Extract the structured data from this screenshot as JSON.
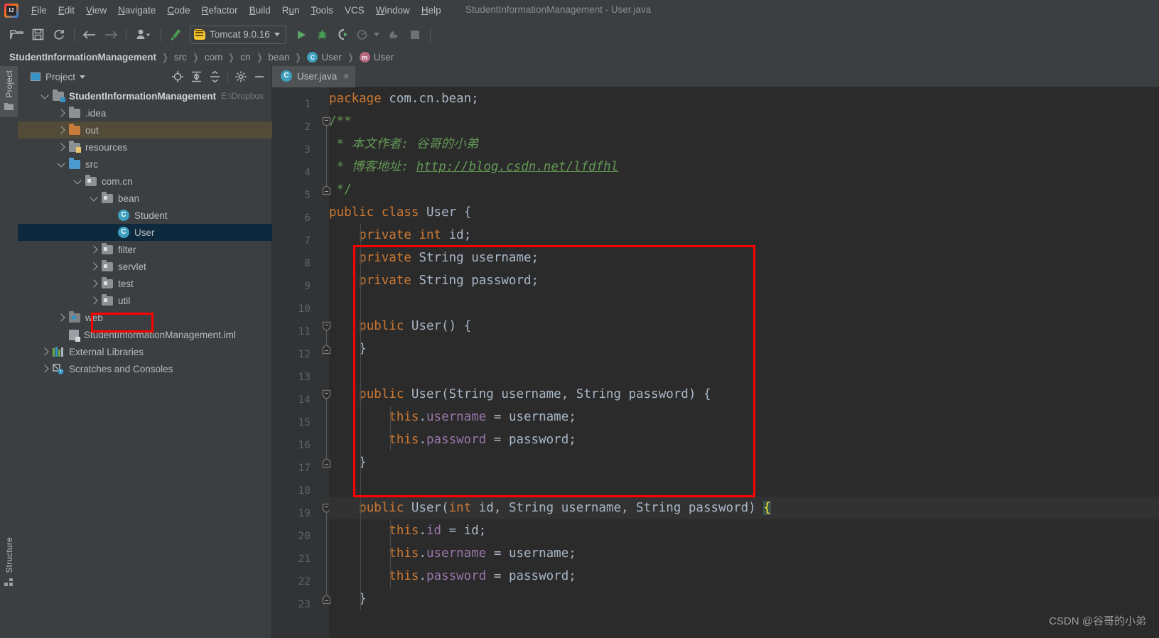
{
  "window": {
    "title": "StudentInformationManagement - User.java",
    "app_icon": "intellij-idea-logo"
  },
  "menubar": {
    "items": [
      {
        "label": "File",
        "mnemonic": "F"
      },
      {
        "label": "Edit",
        "mnemonic": "E"
      },
      {
        "label": "View",
        "mnemonic": "V"
      },
      {
        "label": "Navigate",
        "mnemonic": "N"
      },
      {
        "label": "Code",
        "mnemonic": "C"
      },
      {
        "label": "Refactor",
        "mnemonic": "R"
      },
      {
        "label": "Build",
        "mnemonic": "B"
      },
      {
        "label": "Run",
        "mnemonic": "u"
      },
      {
        "label": "Tools",
        "mnemonic": "T"
      },
      {
        "label": "VCS",
        "mnemonic": ""
      },
      {
        "label": "Window",
        "mnemonic": "W"
      },
      {
        "label": "Help",
        "mnemonic": "H"
      }
    ]
  },
  "toolbar": {
    "icons": [
      "open-folder-icon",
      "save-all-icon",
      "sync-refresh-icon",
      "navigate-back-icon",
      "navigate-forward-icon",
      "user-profile-icon",
      "build-hammer-icon"
    ],
    "run_config": {
      "label": "Tomcat 9.0.16",
      "icon": "tomcat-icon",
      "dropdown": "chevron-down-icon"
    },
    "run_label": "Run",
    "debug_label": "Debug",
    "run_coverage_label": "Run with Coverage",
    "profile_label": "Profile",
    "stop_label": "Stop"
  },
  "breadcrumb": {
    "items": [
      {
        "label": "StudentInformationManagement",
        "bold": true,
        "badge": ""
      },
      {
        "label": "src",
        "bold": false,
        "badge": ""
      },
      {
        "label": "com",
        "bold": false,
        "badge": ""
      },
      {
        "label": "cn",
        "bold": false,
        "badge": ""
      },
      {
        "label": "bean",
        "bold": false,
        "badge": ""
      },
      {
        "label": "User",
        "bold": false,
        "badge": "C"
      },
      {
        "label": "User",
        "bold": false,
        "badge": "m"
      }
    ]
  },
  "rail": {
    "project_tab": "Project",
    "structure_tab": "Structure"
  },
  "project_panel": {
    "title": "Project",
    "dropdown_icon": "chevron-down-icon",
    "tools": [
      "locate-target-icon",
      "expand-all-icon",
      "collapse-all-icon",
      "settings-gear-icon",
      "hide-minimize-icon"
    ],
    "tree": [
      {
        "label": "StudentInformationManagement",
        "path": "E:\\Dropbox",
        "indent": 0,
        "expander": "down",
        "icon": "module-folder",
        "bold": true,
        "state": "normal"
      },
      {
        "label": ".idea",
        "path": "",
        "indent": 1,
        "expander": "right",
        "icon": "folder",
        "bold": false,
        "state": "normal"
      },
      {
        "label": "out",
        "path": "",
        "indent": 1,
        "expander": "right",
        "icon": "folder-orange",
        "bold": false,
        "state": "excluded"
      },
      {
        "label": "resources",
        "path": "",
        "indent": 1,
        "expander": "right",
        "icon": "folder-resources",
        "bold": false,
        "state": "normal"
      },
      {
        "label": "src",
        "path": "",
        "indent": 1,
        "expander": "down",
        "icon": "folder-source",
        "bold": false,
        "state": "normal"
      },
      {
        "label": "com.cn",
        "path": "",
        "indent": 2,
        "expander": "down",
        "icon": "package",
        "bold": false,
        "state": "normal"
      },
      {
        "label": "bean",
        "path": "",
        "indent": 3,
        "expander": "down",
        "icon": "package",
        "bold": false,
        "state": "normal"
      },
      {
        "label": "Student",
        "path": "",
        "indent": 4,
        "expander": "none",
        "icon": "java-class",
        "bold": false,
        "state": "normal"
      },
      {
        "label": "User",
        "path": "",
        "indent": 4,
        "expander": "none",
        "icon": "java-class",
        "bold": false,
        "state": "selected"
      },
      {
        "label": "filter",
        "path": "",
        "indent": 3,
        "expander": "right",
        "icon": "package",
        "bold": false,
        "state": "normal"
      },
      {
        "label": "servlet",
        "path": "",
        "indent": 3,
        "expander": "right",
        "icon": "package",
        "bold": false,
        "state": "normal"
      },
      {
        "label": "test",
        "path": "",
        "indent": 3,
        "expander": "right",
        "icon": "package",
        "bold": false,
        "state": "normal"
      },
      {
        "label": "util",
        "path": "",
        "indent": 3,
        "expander": "right",
        "icon": "package",
        "bold": false,
        "state": "normal"
      },
      {
        "label": "web",
        "path": "",
        "indent": 1,
        "expander": "right",
        "icon": "folder-web",
        "bold": false,
        "state": "normal"
      },
      {
        "label": "StudentInformationManagement.iml",
        "path": "",
        "indent": 1,
        "expander": "none",
        "icon": "iml-file",
        "bold": false,
        "state": "normal"
      },
      {
        "label": "External Libraries",
        "path": "",
        "indent": 0,
        "expander": "right",
        "icon": "libraries",
        "bold": false,
        "state": "normal"
      },
      {
        "label": "Scratches and Consoles",
        "path": "",
        "indent": 0,
        "expander": "right",
        "icon": "scratches",
        "bold": false,
        "state": "normal"
      }
    ]
  },
  "editor": {
    "tab": {
      "label": "User.java",
      "icon": "java-class-icon",
      "close": "×"
    },
    "line_numbers": [
      1,
      2,
      3,
      4,
      5,
      6,
      7,
      8,
      9,
      10,
      11,
      12,
      13,
      14,
      15,
      16,
      17,
      18,
      19,
      20,
      21,
      22,
      23
    ],
    "highlighted_line": 19,
    "code_lines": [
      "package com.cn.bean;",
      "/**",
      " * 本文作者: 谷哥的小弟",
      " * 博客地址: http://blog.csdn.net/lfdfhl",
      " */",
      "public class User {",
      "    private int id;",
      "    private String username;",
      "    private String password;",
      "",
      "    public User() {",
      "    }",
      "",
      "    public User(String username, String password) {",
      "        this.username = username;",
      "        this.password = password;",
      "    }",
      "",
      "    public User(int id, String username, String password) {",
      "        this.id = id;",
      "        this.username = username;",
      "        this.password = password;",
      "    }"
    ]
  },
  "annotations": {
    "code_highlight_box_color": "#FF0000",
    "tree_highlight_box_color": "#FF0000"
  },
  "watermark": {
    "text": "CSDN @谷哥的小弟"
  },
  "colors": {
    "editor_bg": "#2B2B2B",
    "panel_bg": "#3C3F41",
    "gutter_bg": "#313335",
    "keyword": "#CC7832",
    "identifier": "#A9B7C6",
    "field": "#9876AA",
    "comment": "#629755",
    "selection": "#0D293E",
    "excluded": "#514B38",
    "accent": "#3592C4"
  }
}
